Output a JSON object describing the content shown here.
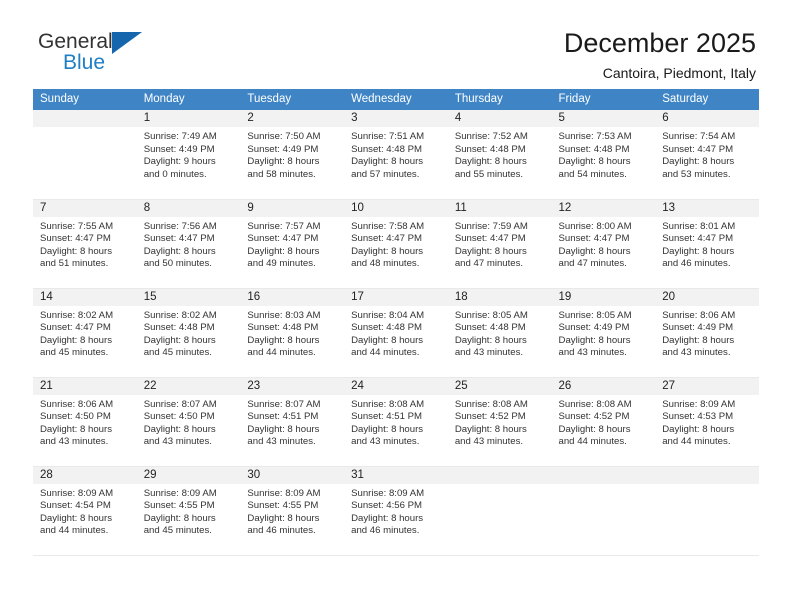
{
  "brand": {
    "name_top": "General",
    "name_bottom": "Blue",
    "triangle_color": "#1566ad",
    "blue_color": "#1d7fc4"
  },
  "header": {
    "title": "December 2025",
    "subtitle": "Cantoira, Piedmont, Italy"
  },
  "calendar": {
    "header_bg": "#3f85c6",
    "daynum_bg": "#f2f2f2",
    "weekday_headers": [
      "Sunday",
      "Monday",
      "Tuesday",
      "Wednesday",
      "Thursday",
      "Friday",
      "Saturday"
    ],
    "weeks": [
      [
        {
          "empty": true
        },
        {
          "day": "1",
          "sunrise": "Sunrise: 7:49 AM",
          "sunset": "Sunset: 4:49 PM",
          "daylight1": "Daylight: 9 hours",
          "daylight2": "and 0 minutes."
        },
        {
          "day": "2",
          "sunrise": "Sunrise: 7:50 AM",
          "sunset": "Sunset: 4:49 PM",
          "daylight1": "Daylight: 8 hours",
          "daylight2": "and 58 minutes."
        },
        {
          "day": "3",
          "sunrise": "Sunrise: 7:51 AM",
          "sunset": "Sunset: 4:48 PM",
          "daylight1": "Daylight: 8 hours",
          "daylight2": "and 57 minutes."
        },
        {
          "day": "4",
          "sunrise": "Sunrise: 7:52 AM",
          "sunset": "Sunset: 4:48 PM",
          "daylight1": "Daylight: 8 hours",
          "daylight2": "and 55 minutes."
        },
        {
          "day": "5",
          "sunrise": "Sunrise: 7:53 AM",
          "sunset": "Sunset: 4:48 PM",
          "daylight1": "Daylight: 8 hours",
          "daylight2": "and 54 minutes."
        },
        {
          "day": "6",
          "sunrise": "Sunrise: 7:54 AM",
          "sunset": "Sunset: 4:47 PM",
          "daylight1": "Daylight: 8 hours",
          "daylight2": "and 53 minutes."
        }
      ],
      [
        {
          "day": "7",
          "sunrise": "Sunrise: 7:55 AM",
          "sunset": "Sunset: 4:47 PM",
          "daylight1": "Daylight: 8 hours",
          "daylight2": "and 51 minutes."
        },
        {
          "day": "8",
          "sunrise": "Sunrise: 7:56 AM",
          "sunset": "Sunset: 4:47 PM",
          "daylight1": "Daylight: 8 hours",
          "daylight2": "and 50 minutes."
        },
        {
          "day": "9",
          "sunrise": "Sunrise: 7:57 AM",
          "sunset": "Sunset: 4:47 PM",
          "daylight1": "Daylight: 8 hours",
          "daylight2": "and 49 minutes."
        },
        {
          "day": "10",
          "sunrise": "Sunrise: 7:58 AM",
          "sunset": "Sunset: 4:47 PM",
          "daylight1": "Daylight: 8 hours",
          "daylight2": "and 48 minutes."
        },
        {
          "day": "11",
          "sunrise": "Sunrise: 7:59 AM",
          "sunset": "Sunset: 4:47 PM",
          "daylight1": "Daylight: 8 hours",
          "daylight2": "and 47 minutes."
        },
        {
          "day": "12",
          "sunrise": "Sunrise: 8:00 AM",
          "sunset": "Sunset: 4:47 PM",
          "daylight1": "Daylight: 8 hours",
          "daylight2": "and 47 minutes."
        },
        {
          "day": "13",
          "sunrise": "Sunrise: 8:01 AM",
          "sunset": "Sunset: 4:47 PM",
          "daylight1": "Daylight: 8 hours",
          "daylight2": "and 46 minutes."
        }
      ],
      [
        {
          "day": "14",
          "sunrise": "Sunrise: 8:02 AM",
          "sunset": "Sunset: 4:47 PM",
          "daylight1": "Daylight: 8 hours",
          "daylight2": "and 45 minutes."
        },
        {
          "day": "15",
          "sunrise": "Sunrise: 8:02 AM",
          "sunset": "Sunset: 4:48 PM",
          "daylight1": "Daylight: 8 hours",
          "daylight2": "and 45 minutes."
        },
        {
          "day": "16",
          "sunrise": "Sunrise: 8:03 AM",
          "sunset": "Sunset: 4:48 PM",
          "daylight1": "Daylight: 8 hours",
          "daylight2": "and 44 minutes."
        },
        {
          "day": "17",
          "sunrise": "Sunrise: 8:04 AM",
          "sunset": "Sunset: 4:48 PM",
          "daylight1": "Daylight: 8 hours",
          "daylight2": "and 44 minutes."
        },
        {
          "day": "18",
          "sunrise": "Sunrise: 8:05 AM",
          "sunset": "Sunset: 4:48 PM",
          "daylight1": "Daylight: 8 hours",
          "daylight2": "and 43 minutes."
        },
        {
          "day": "19",
          "sunrise": "Sunrise: 8:05 AM",
          "sunset": "Sunset: 4:49 PM",
          "daylight1": "Daylight: 8 hours",
          "daylight2": "and 43 minutes."
        },
        {
          "day": "20",
          "sunrise": "Sunrise: 8:06 AM",
          "sunset": "Sunset: 4:49 PM",
          "daylight1": "Daylight: 8 hours",
          "daylight2": "and 43 minutes."
        }
      ],
      [
        {
          "day": "21",
          "sunrise": "Sunrise: 8:06 AM",
          "sunset": "Sunset: 4:50 PM",
          "daylight1": "Daylight: 8 hours",
          "daylight2": "and 43 minutes."
        },
        {
          "day": "22",
          "sunrise": "Sunrise: 8:07 AM",
          "sunset": "Sunset: 4:50 PM",
          "daylight1": "Daylight: 8 hours",
          "daylight2": "and 43 minutes."
        },
        {
          "day": "23",
          "sunrise": "Sunrise: 8:07 AM",
          "sunset": "Sunset: 4:51 PM",
          "daylight1": "Daylight: 8 hours",
          "daylight2": "and 43 minutes."
        },
        {
          "day": "24",
          "sunrise": "Sunrise: 8:08 AM",
          "sunset": "Sunset: 4:51 PM",
          "daylight1": "Daylight: 8 hours",
          "daylight2": "and 43 minutes."
        },
        {
          "day": "25",
          "sunrise": "Sunrise: 8:08 AM",
          "sunset": "Sunset: 4:52 PM",
          "daylight1": "Daylight: 8 hours",
          "daylight2": "and 43 minutes."
        },
        {
          "day": "26",
          "sunrise": "Sunrise: 8:08 AM",
          "sunset": "Sunset: 4:52 PM",
          "daylight1": "Daylight: 8 hours",
          "daylight2": "and 44 minutes."
        },
        {
          "day": "27",
          "sunrise": "Sunrise: 8:09 AM",
          "sunset": "Sunset: 4:53 PM",
          "daylight1": "Daylight: 8 hours",
          "daylight2": "and 44 minutes."
        }
      ],
      [
        {
          "day": "28",
          "sunrise": "Sunrise: 8:09 AM",
          "sunset": "Sunset: 4:54 PM",
          "daylight1": "Daylight: 8 hours",
          "daylight2": "and 44 minutes."
        },
        {
          "day": "29",
          "sunrise": "Sunrise: 8:09 AM",
          "sunset": "Sunset: 4:55 PM",
          "daylight1": "Daylight: 8 hours",
          "daylight2": "and 45 minutes."
        },
        {
          "day": "30",
          "sunrise": "Sunrise: 8:09 AM",
          "sunset": "Sunset: 4:55 PM",
          "daylight1": "Daylight: 8 hours",
          "daylight2": "and 46 minutes."
        },
        {
          "day": "31",
          "sunrise": "Sunrise: 8:09 AM",
          "sunset": "Sunset: 4:56 PM",
          "daylight1": "Daylight: 8 hours",
          "daylight2": "and 46 minutes."
        },
        {
          "empty": true
        },
        {
          "empty": true
        },
        {
          "empty": true
        }
      ]
    ]
  }
}
